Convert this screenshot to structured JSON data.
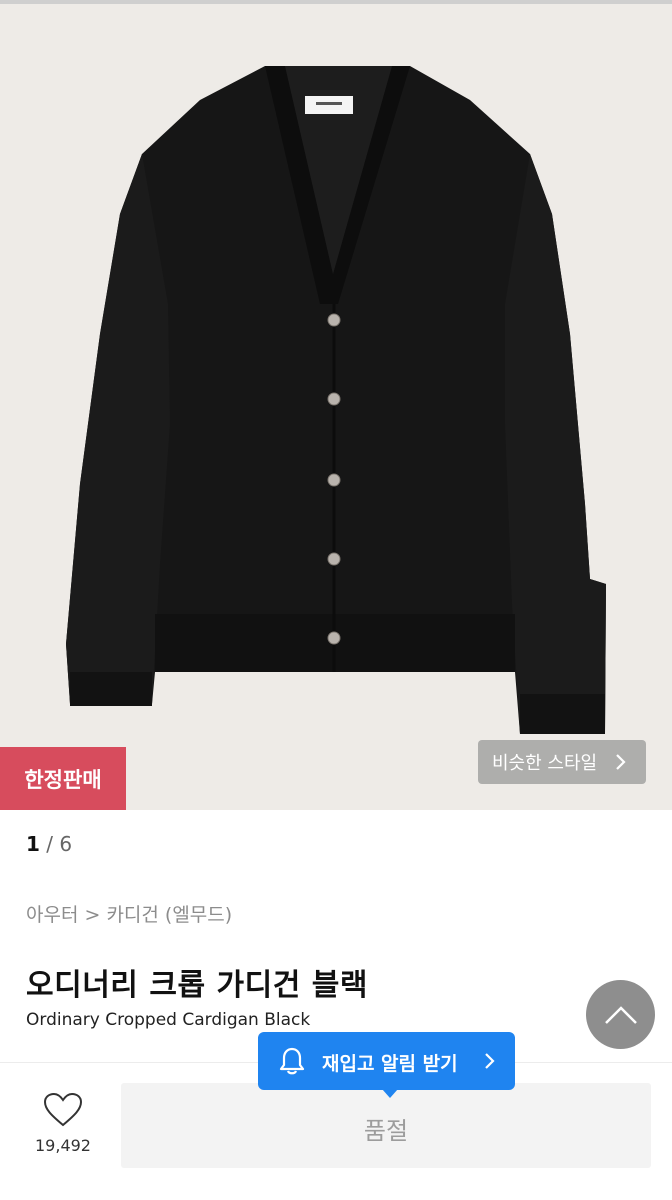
{
  "product_image": {
    "alt": "cardigan-image",
    "background": "#eeebe7"
  },
  "badges": {
    "limited": "한정판매"
  },
  "similar_style": {
    "label": "비슷한 스타일"
  },
  "pager": {
    "current": "1",
    "separator": " / ",
    "total": "6"
  },
  "breadcrumb": "아우터 > 카디건 (엘무드)",
  "product": {
    "title_ko": "오디너리 크롭 가디건 블랙",
    "title_en": "Ordinary Cropped Cardigan Black"
  },
  "restock": {
    "label": "재입고 알림 받기"
  },
  "like": {
    "count": "19,492"
  },
  "purchase": {
    "label": "품절"
  },
  "colors": {
    "limited_badge": "#d74c5d",
    "restock": "#1f84f0",
    "scroll_top": "#8e8e8e"
  }
}
